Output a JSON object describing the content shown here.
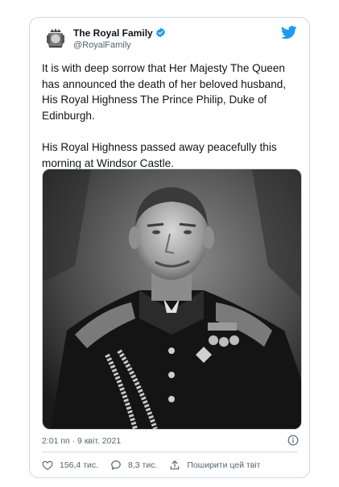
{
  "tweet": {
    "author_name": "The Royal Family",
    "author_handle": "@RoyalFamily",
    "paragraphs": [
      "It is with deep sorrow that Her Majesty The Queen has announced the death of her beloved husband, His Royal Highness The Prince Philip, Duke of Edinburgh.",
      "His Royal Highness passed away peacefully this morning at Windsor Castle."
    ],
    "timestamp": "2:01 пп · 9 квіт. 2021",
    "likes": "156,4 тис.",
    "replies": "8,3 тис.",
    "share_label": "Поширити цей твіт"
  },
  "icons": {
    "avatar": "royal-coat-of-arms",
    "verified": "verified-badge-icon",
    "brand": "twitter-bird-icon",
    "info": "info-icon",
    "like": "heart-icon",
    "reply": "reply-icon",
    "share": "share-icon"
  },
  "colors": {
    "twitter_blue": "#1d9bf0",
    "text_primary": "#0f1419",
    "text_secondary": "#536471",
    "border": "#cfd9de"
  }
}
